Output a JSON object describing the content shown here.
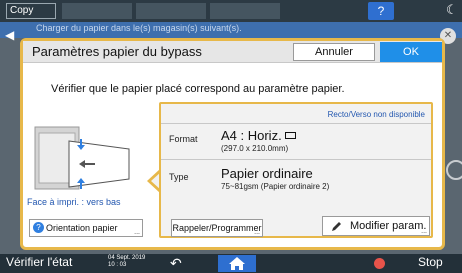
{
  "background": {
    "app_label": "Copy",
    "help_label": "?",
    "sub_text": "Charger du papier dans le(s) magasin(s) suivant(s)."
  },
  "dialog": {
    "title": "Paramètres papier du bypass",
    "cancel_label": "Annuler",
    "ok_label": "OK",
    "instruction": "Vérifier que le papier placé correspond au paramètre papier.",
    "tray_label": "Face à impri. : vers bas",
    "orientation_button": "Orientation papier",
    "duplex_note": "Recto/Verso non disponible",
    "format": {
      "label": "Format",
      "value": "A4 : Horiz.",
      "detail": "(297.0 x 210.0mm)"
    },
    "type": {
      "label": "Type",
      "value": "Papier ordinaire",
      "detail": "75~81gsm (Papier ordinaire 2)"
    },
    "recall_button": "Rappeler/Programmer",
    "modify_button": "Modifier param."
  },
  "bottom_bar": {
    "check_status": "Vérifier l'état",
    "date": "04 Sept. 2019",
    "time": "10 : 03",
    "stop_label": "Stop"
  },
  "colors": {
    "accent_border": "#e7b84a",
    "ok_blue": "#1f8fe8",
    "link_blue": "#2458b0"
  }
}
